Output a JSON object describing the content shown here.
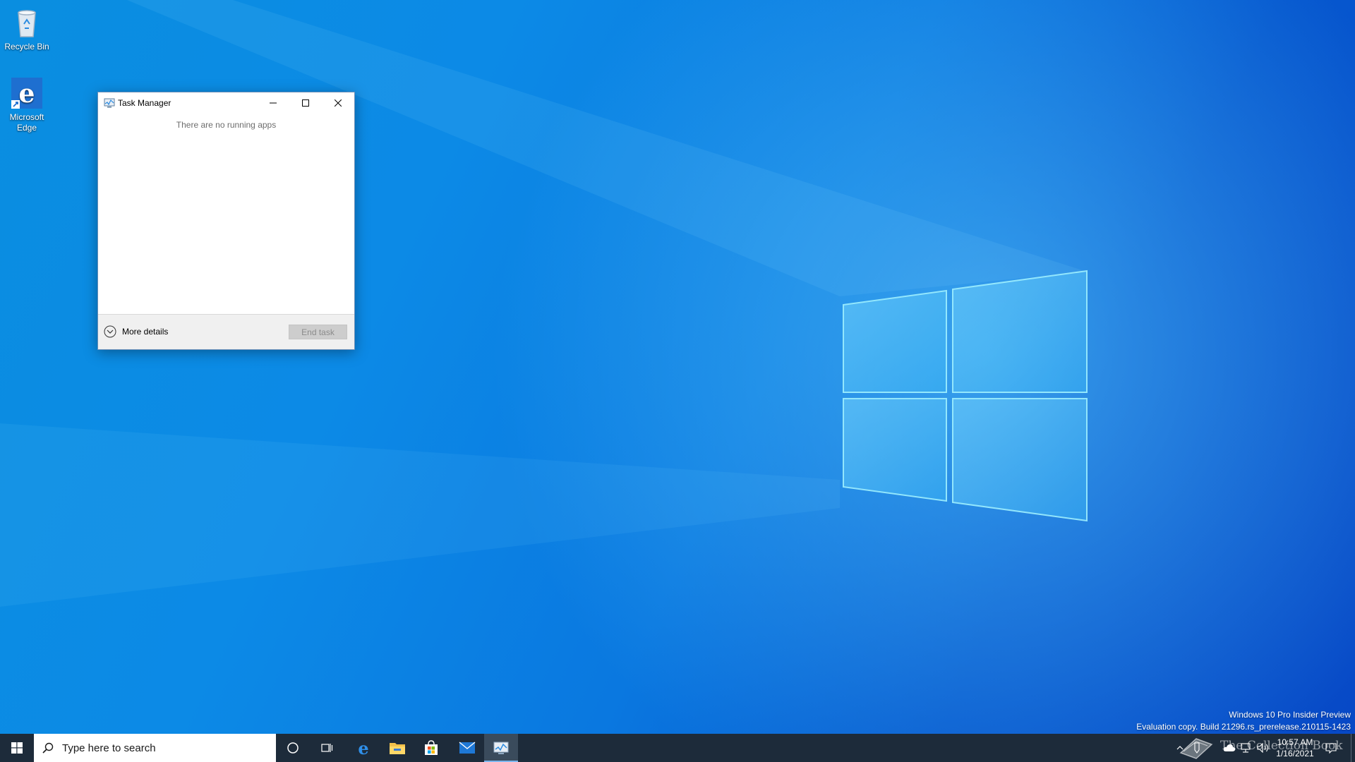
{
  "desktop": {
    "icons": [
      {
        "label": "Recycle Bin"
      },
      {
        "label": "Microsoft Edge"
      }
    ]
  },
  "window": {
    "title": "Task Manager",
    "empty_message": "There are no running apps",
    "more_details_label": "More details",
    "end_task_label": "End task"
  },
  "watermark": {
    "line1": "Windows 10 Pro Insider Preview",
    "line2": "Evaluation copy. Build 21296.rs_prerelease.210115-1423"
  },
  "taskbar": {
    "search_placeholder": "Type here to search",
    "clock_time": "10:57 AM",
    "clock_date": "1/16/2021",
    "brand_watermark": "The Collection Book",
    "pinned_apps": [
      "cortana-icon",
      "task-view-icon",
      "edge-icon",
      "file-explorer-icon",
      "store-icon",
      "mail-icon",
      "task-manager-icon"
    ]
  },
  "colors": {
    "taskbar": "#1d2b3a",
    "accent": "#0a78e0"
  }
}
